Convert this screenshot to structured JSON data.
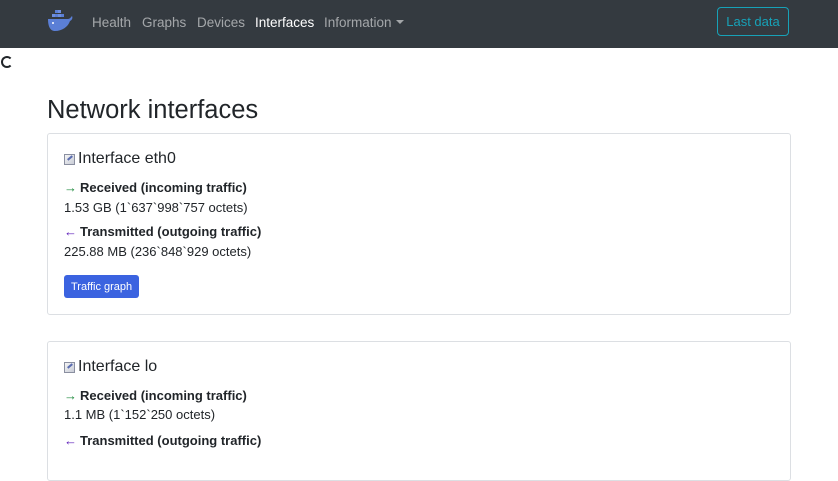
{
  "nav": {
    "items": [
      {
        "label": "Health"
      },
      {
        "label": "Graphs"
      },
      {
        "label": "Devices"
      },
      {
        "label": "Interfaces"
      },
      {
        "label": "Information"
      }
    ],
    "active": "Interfaces",
    "last_data_label": "Last data"
  },
  "page": {
    "title": "Network interfaces"
  },
  "interfaces": [
    {
      "title": "Interface eth0",
      "received_label": "Received (incoming traffic)",
      "received_value": "1.53 GB (1`637`998`757 octets)",
      "transmitted_label": "Transmitted (outgoing traffic)",
      "transmitted_value": "225.88 MB (236`848`929 octets)",
      "button_label": "Traffic graph"
    },
    {
      "title": "Interface lo",
      "received_label": "Received (incoming traffic)",
      "received_value": "1.1 MB (1`152`250 octets)",
      "transmitted_label": "Transmitted (outgoing traffic)"
    }
  ],
  "icons": {
    "brand": "docker-whale-icon",
    "interface": "network-interface-icon",
    "received": "right-arrow-icon",
    "transmitted": "left-arrow-icon",
    "loading": "loading-spinner-icon"
  },
  "colors": {
    "navbar": "#343a40",
    "accent_teal": "#17a2b8",
    "button_primary": "#3b63e0",
    "received_arrow": "#1e8a3c",
    "transmitted_arrow": "#5a19b8"
  }
}
